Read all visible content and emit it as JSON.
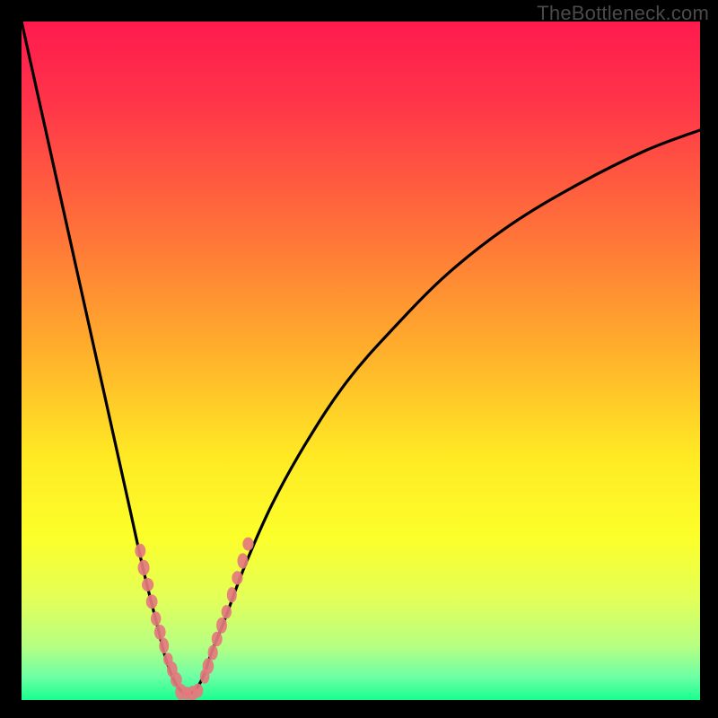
{
  "watermark": "TheBottleneck.com",
  "chart_data": {
    "type": "line",
    "title": "",
    "xlabel": "",
    "ylabel": "",
    "xlim": [
      0,
      100
    ],
    "ylim": [
      0,
      100
    ],
    "background_gradient_stops": [
      {
        "t": 0.0,
        "color": "#ff1a4e"
      },
      {
        "t": 0.12,
        "color": "#ff3549"
      },
      {
        "t": 0.3,
        "color": "#ff6f3a"
      },
      {
        "t": 0.48,
        "color": "#ffad2c"
      },
      {
        "t": 0.64,
        "color": "#ffe924"
      },
      {
        "t": 0.76,
        "color": "#fcff2a"
      },
      {
        "t": 0.85,
        "color": "#e3ff58"
      },
      {
        "t": 0.92,
        "color": "#b7ff82"
      },
      {
        "t": 0.965,
        "color": "#6fffa4"
      },
      {
        "t": 1.0,
        "color": "#18ff8f"
      }
    ],
    "series": [
      {
        "name": "bottleneck-curve",
        "x": [
          0,
          2,
          4,
          6,
          8,
          10,
          12,
          14,
          16,
          18,
          20,
          21,
          22,
          23,
          24,
          25,
          26,
          27,
          28,
          30,
          33,
          37,
          42,
          48,
          55,
          63,
          72,
          82,
          92,
          100
        ],
        "y": [
          100,
          91,
          82,
          73,
          64,
          55,
          46,
          37,
          28,
          19,
          11,
          7,
          4,
          2,
          1,
          1,
          2,
          4,
          7,
          12,
          20,
          29,
          38,
          47,
          55,
          63,
          70,
          76,
          81,
          84
        ]
      },
      {
        "name": "segment-markers-left",
        "x": [
          17.5,
          18.0,
          18.6,
          19.2,
          19.8,
          20.4,
          21.0,
          21.6,
          22.2,
          22.8
        ],
        "y": [
          22,
          19.5,
          17,
          14.5,
          12,
          10,
          8,
          6,
          4.5,
          3
        ]
      },
      {
        "name": "segment-markers-bottom",
        "x": [
          23.5,
          24.3,
          25.2,
          26.0
        ],
        "y": [
          1.2,
          1.0,
          1.0,
          1.4
        ]
      },
      {
        "name": "segment-markers-right",
        "x": [
          27.0,
          27.5,
          28.2,
          28.8,
          29.5,
          30.2,
          31.0,
          31.8,
          32.6,
          33.4
        ],
        "y": [
          3.5,
          5,
          7,
          9,
          11,
          13,
          15.5,
          18,
          20.5,
          23
        ]
      }
    ],
    "marker_color": "#e47a7e",
    "curve_stroke": "#000000",
    "curve_width": 3.2
  }
}
